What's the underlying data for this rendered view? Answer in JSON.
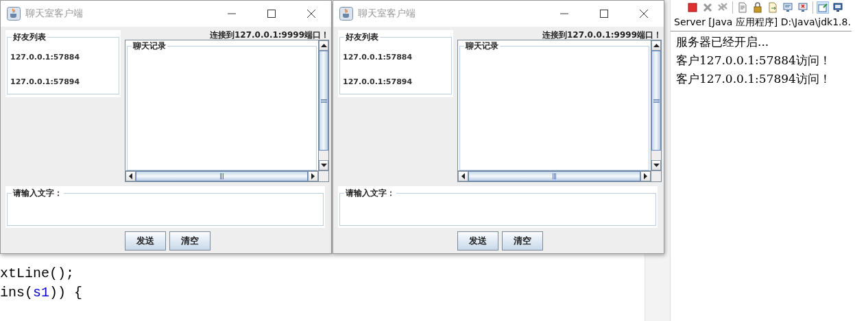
{
  "editor": {
    "lines": [
      [
        {
          "text": "xtLine();",
          "kind": "plain"
        }
      ],
      [
        {
          "text": "ins(",
          "kind": "plain"
        },
        {
          "text": "s1",
          "kind": "variable"
        },
        {
          "text": ")) {",
          "kind": "plain"
        }
      ]
    ]
  },
  "windows": [
    {
      "title": "聊天室客户端",
      "status": "连接到127.0.0.1:9999端口！",
      "friends_list": {
        "title": "好友列表",
        "items": [
          "127.0.0.1:57884",
          "127.0.0.1:57894"
        ]
      },
      "chat_log": {
        "title": "聊天记录"
      },
      "message_input": {
        "title": "请输入文字："
      },
      "buttons": [
        "发送",
        "清空"
      ]
    },
    {
      "title": "聊天室客户端",
      "status": "连接到127.0.0.1:9999端口！",
      "friends_list": {
        "title": "好友列表",
        "items": [
          "127.0.0.1:57884",
          "127.0.0.1:57894"
        ]
      },
      "chat_log": {
        "title": "聊天记录"
      },
      "message_input": {
        "title": "请输入文字："
      },
      "buttons": [
        "发送",
        "清空"
      ]
    }
  ],
  "console": {
    "header": "Server [Java 应用程序] D:\\Java\\jdk1.8.",
    "lines": [
      "服务器已经开启...",
      "客户127.0.0.1:57884访问！",
      "客户127.0.0.1:57894访问！"
    ]
  }
}
